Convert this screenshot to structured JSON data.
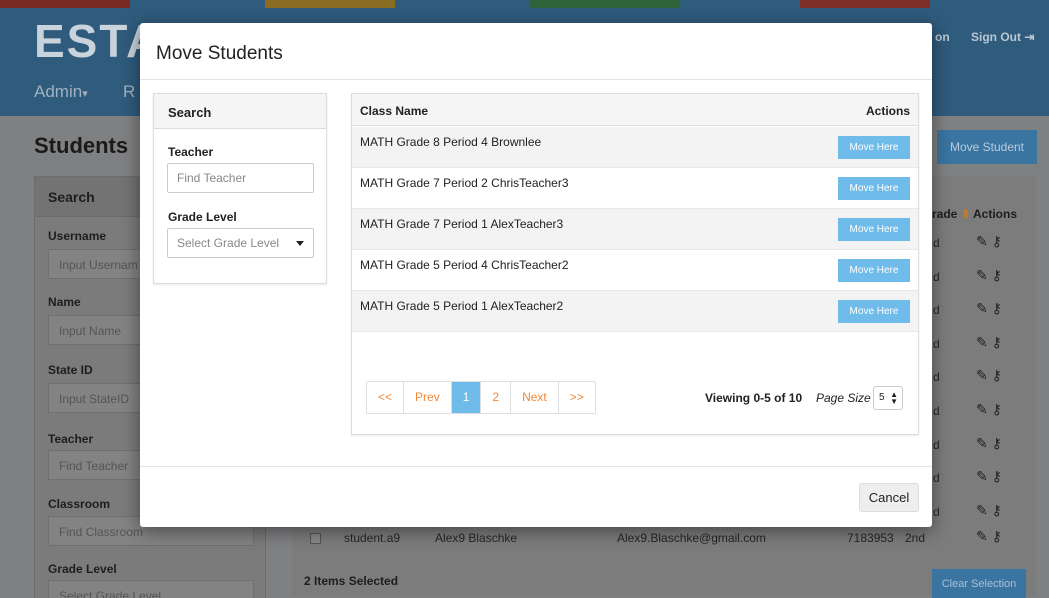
{
  "app": {
    "logo": "ESTA",
    "nav_links": [
      "on",
      "Sign Out"
    ],
    "menu_items": [
      "Admin",
      "R"
    ],
    "stripe_colors": [
      "#b23a2e",
      "#e0a52c",
      "#4aa05a",
      "#c1463a",
      "#2e6e9e"
    ]
  },
  "page": {
    "title": "Students",
    "move_student_button": "Move Student"
  },
  "left_panel": {
    "title": "Search",
    "fields": [
      {
        "label": "Username",
        "placeholder": "Input Usernam"
      },
      {
        "label": "Name",
        "placeholder": "Input Name"
      },
      {
        "label": "State ID",
        "placeholder": "Input StateID"
      },
      {
        "label": "Teacher",
        "placeholder": "Find Teacher"
      },
      {
        "label": "Classroom",
        "placeholder": "Find Classroom"
      },
      {
        "label": "Grade Level",
        "placeholder": "Select Grade Level"
      }
    ]
  },
  "student_table": {
    "headers": [
      "rade",
      "Actions"
    ],
    "row_grade_fragments": [
      "d",
      "d",
      "d",
      "d",
      "d",
      "d",
      "d",
      "d",
      "d"
    ],
    "last_row": {
      "username": "student.a9",
      "name": "Alex9 Blaschke",
      "email": "Alex9.Blaschke@gmail.com",
      "state_id": "7183953",
      "grade": "2nd"
    },
    "items_selected": "2 Items Selected",
    "clear_selection": "Clear Selection"
  },
  "modal": {
    "title": "Move Students",
    "search": {
      "title": "Search",
      "teacher_label": "Teacher",
      "teacher_placeholder": "Find Teacher",
      "grade_label": "Grade Level",
      "grade_placeholder": "Select Grade Level"
    },
    "classes": {
      "col_name": "Class Name",
      "col_actions": "Actions",
      "move_here_label": "Move Here",
      "rows": [
        {
          "name": "MATH Grade 8 Period 4 Brownlee"
        },
        {
          "name": "MATH Grade 7 Period 2 ChrisTeacher3"
        },
        {
          "name": "MATH Grade 7 Period 1 AlexTeacher3"
        },
        {
          "name": "MATH Grade 5 Period 4 ChrisTeacher2"
        },
        {
          "name": "MATH Grade 5 Period 1 AlexTeacher2"
        }
      ]
    },
    "pagination": {
      "first": "<<",
      "prev": "Prev",
      "pages": [
        "1",
        "2"
      ],
      "current_page": "1",
      "next": "Next",
      "last": ">>",
      "viewing": "Viewing 0-5 of 10",
      "page_size_label": "Page Size",
      "page_size": "5"
    },
    "cancel_label": "Cancel"
  },
  "colors": {
    "accent": "#6fbbe9",
    "link": "#f0883a",
    "header": "#2f5b7c"
  }
}
